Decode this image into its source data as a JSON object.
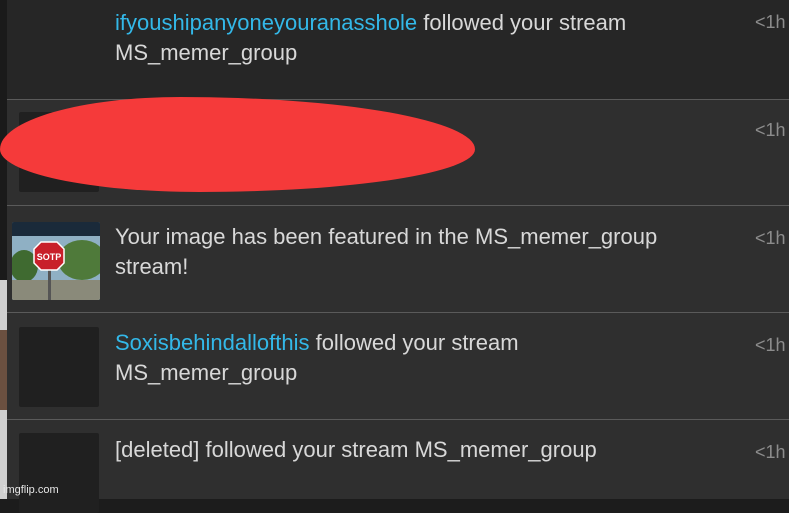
{
  "notifications": [
    {
      "user": "ifyoushipanyoneyouranasshole",
      "text": " followed your stream",
      "stream": "MS_memer_group",
      "time": "<1h"
    },
    {
      "user": "",
      "text": "",
      "stream": "",
      "time": "<1h"
    },
    {
      "user": "",
      "text": "Your image has been featured in the MS_memer_group",
      "stream": "stream!",
      "time": "<1h",
      "thumb_label": "SOTP"
    },
    {
      "user": "Soxisbehindallofthis",
      "text": " followed your stream",
      "stream": "MS_memer_group",
      "time": "<1h"
    },
    {
      "user": "",
      "text": "[deleted] followed your stream MS_memer_group",
      "stream": "",
      "time": "<1h"
    }
  ],
  "watermark": "imgflip.com",
  "colors": {
    "username": "#33b8e8",
    "redaction": "#f53a3a"
  }
}
